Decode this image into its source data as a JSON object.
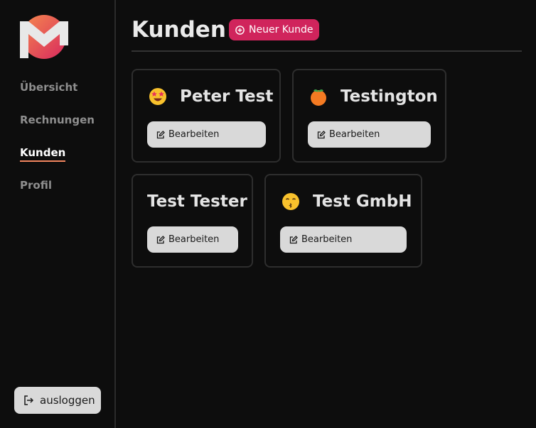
{
  "sidebar": {
    "logo_icon": "m-logo-icon",
    "nav": [
      {
        "label": "Übersicht",
        "active": false
      },
      {
        "label": "Rechnungen",
        "active": false
      },
      {
        "label": "Kunden",
        "active": true
      },
      {
        "label": "Profil",
        "active": false
      }
    ],
    "logout_label": "ausloggen"
  },
  "header": {
    "title": "Kunden",
    "new_button_label": "Neuer Kunde"
  },
  "customers": [
    {
      "name": "Peter Test",
      "emoji": "star-struck-emoji",
      "edit_label": "Bearbeiten"
    },
    {
      "name": "Testington",
      "emoji": "peach-emoji",
      "edit_label": "Bearbeiten"
    },
    {
      "name": "Test Tester",
      "emoji": "",
      "edit_label": "Bearbeiten"
    },
    {
      "name": "Test GmbH",
      "emoji": "kissing-face-emoji",
      "edit_label": "Bearbeiten"
    }
  ],
  "colors": {
    "background": "#0d0d0d",
    "accent": "#d0245c",
    "nav_underline": "#f2855f",
    "button_bg": "#d9d9d9"
  }
}
